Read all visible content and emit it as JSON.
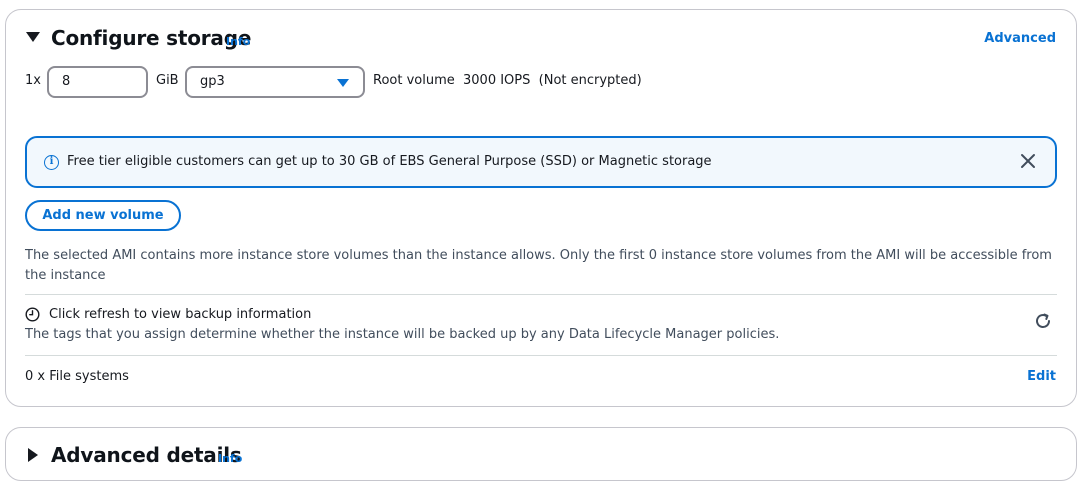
{
  "storage": {
    "title": "Configure storage",
    "info_label": "Info",
    "advanced_label": "Advanced",
    "volume": {
      "count_prefix": "1x",
      "size_value": "8",
      "size_unit": "GiB",
      "type_value": "gp3",
      "description": "Root volume  3000 IOPS  (Not encrypted)"
    },
    "alert": {
      "message": "Free tier eligible customers can get up to 30 GB of EBS General Purpose (SSD) or Magnetic storage"
    },
    "add_volume_label": "Add new volume",
    "ami_warning": "The selected AMI contains more instance store volumes than the instance allows. Only the first 0 instance store volumes from the AMI will be accessible from the instance",
    "backup": {
      "title": "Click refresh to view backup information",
      "description": "The tags that you assign determine whether the instance will be backed up by any Data Lifecycle Manager policies."
    },
    "file_systems": {
      "label": "0 x File systems",
      "edit_label": "Edit"
    }
  },
  "advanced_details": {
    "title": "Advanced details",
    "info_label": "Info"
  },
  "colors": {
    "link": "#0972d3",
    "alert_bg": "#f2f8fd",
    "border": "#c6c6cd"
  },
  "icons": {
    "collapse": "caret-down-icon",
    "expand": "caret-right-icon",
    "info": "info-circle-icon",
    "close": "close-icon",
    "clock": "clock-icon",
    "refresh": "refresh-icon",
    "select": "select-caret-icon"
  }
}
